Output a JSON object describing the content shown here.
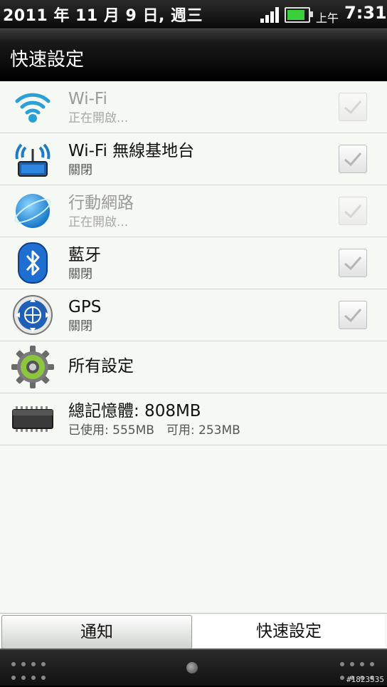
{
  "status_bar": {
    "date": "2011 年 11 月 9 日, 週三",
    "ampm": "上午",
    "time": "7:31",
    "battery_level": 0.85,
    "signal_bars": 4,
    "accent_battery": "#3ccf3c"
  },
  "header": {
    "title": "快速設定"
  },
  "items": [
    {
      "title": "Wi-Fi",
      "subtitle": "正在開啟...",
      "icon": "wifi-icon",
      "disabled": true,
      "checked": true
    },
    {
      "title": "Wi-Fi 無線基地台",
      "subtitle": "關閉",
      "icon": "wifi-hotspot-icon",
      "disabled": false,
      "checked": true
    },
    {
      "title": "行動網路",
      "subtitle": "正在開啟...",
      "icon": "mobile-network-icon",
      "disabled": true,
      "checked": true
    },
    {
      "title": "藍牙",
      "subtitle": "關閉",
      "icon": "bluetooth-icon",
      "disabled": false,
      "checked": true
    },
    {
      "title": "GPS",
      "subtitle": "關閉",
      "icon": "gps-icon",
      "disabled": false,
      "checked": true
    },
    {
      "title": "所有設定",
      "icon": "gear-icon"
    },
    {
      "title": "總記憶體: 808MB",
      "subtitle": "已使用: 555MB　可用: 253MB",
      "icon": "memory-chip-icon"
    }
  ],
  "tabs": {
    "notifications": "通知",
    "quick_settings": "快速設定"
  },
  "watermark": "#1823535"
}
